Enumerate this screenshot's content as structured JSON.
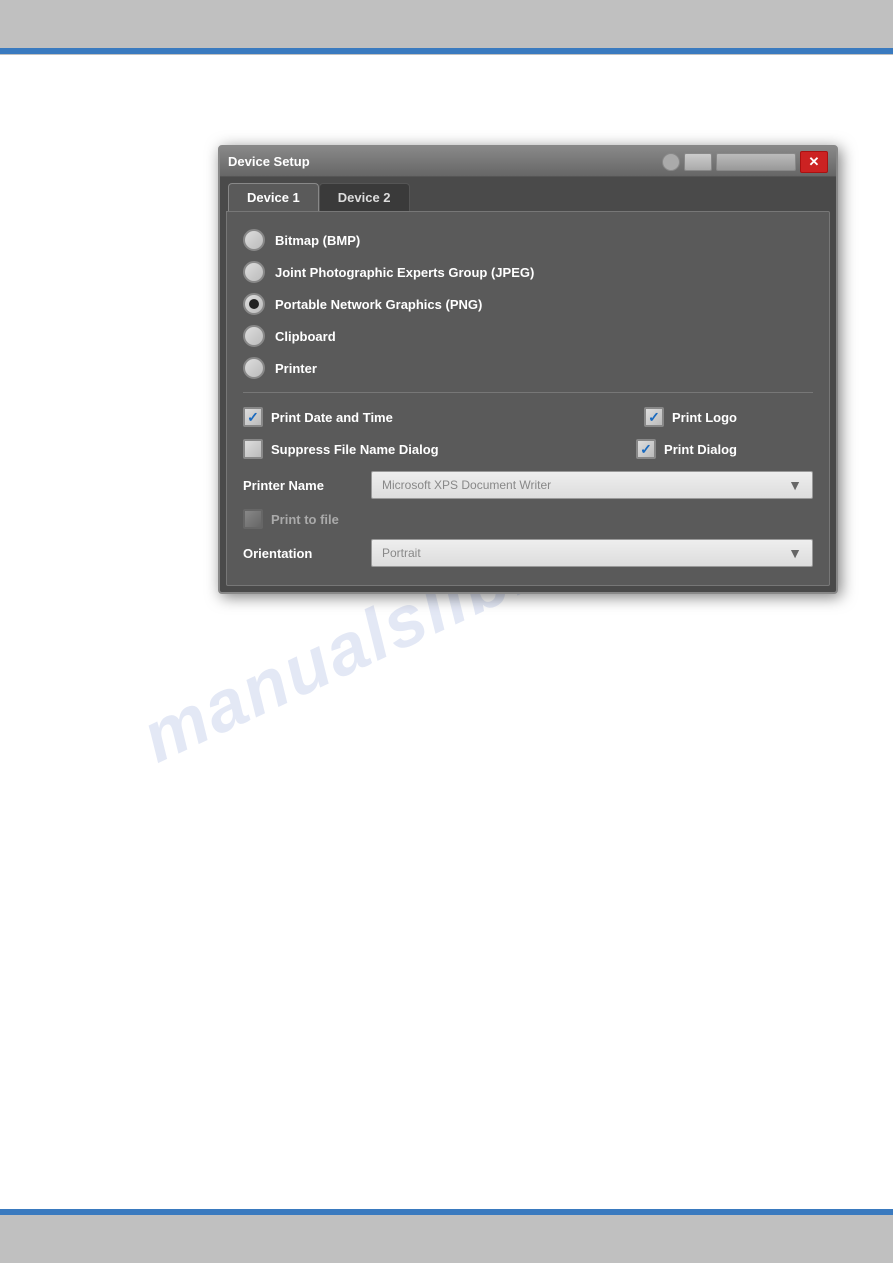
{
  "page": {
    "background": "#ffffff"
  },
  "top_bar": {
    "color": "#c0c0c0"
  },
  "bottom_bar": {
    "color": "#c0c0c0"
  },
  "watermark": {
    "text": "manualslib.com"
  },
  "dialog": {
    "title": "Device Setup",
    "close_button_label": "✕",
    "tabs": [
      {
        "label": "Device 1",
        "active": true
      },
      {
        "label": "Device 2",
        "active": false
      }
    ],
    "radio_options": [
      {
        "label": "Bitmap (BMP)",
        "selected": false
      },
      {
        "label": "Joint Photographic Experts Group (JPEG)",
        "selected": false
      },
      {
        "label": "Portable Network Graphics (PNG)",
        "selected": true
      },
      {
        "label": "Clipboard",
        "selected": false
      },
      {
        "label": "Printer",
        "selected": false
      }
    ],
    "checkboxes_row1": [
      {
        "label": "Print Date and Time",
        "checked": true,
        "dimmed": false
      },
      {
        "label": "Print Logo",
        "checked": true,
        "dimmed": false
      }
    ],
    "checkboxes_row2": [
      {
        "label": "Suppress File Name Dialog",
        "checked": false,
        "dimmed": false
      },
      {
        "label": "Print Dialog",
        "checked": true,
        "dimmed": false
      }
    ],
    "printer_name_label": "Printer Name",
    "printer_name_value": "Microsoft XPS Document Writer",
    "print_to_file_label": "Print to file",
    "orientation_label": "Orientation",
    "orientation_value": "Portrait"
  }
}
